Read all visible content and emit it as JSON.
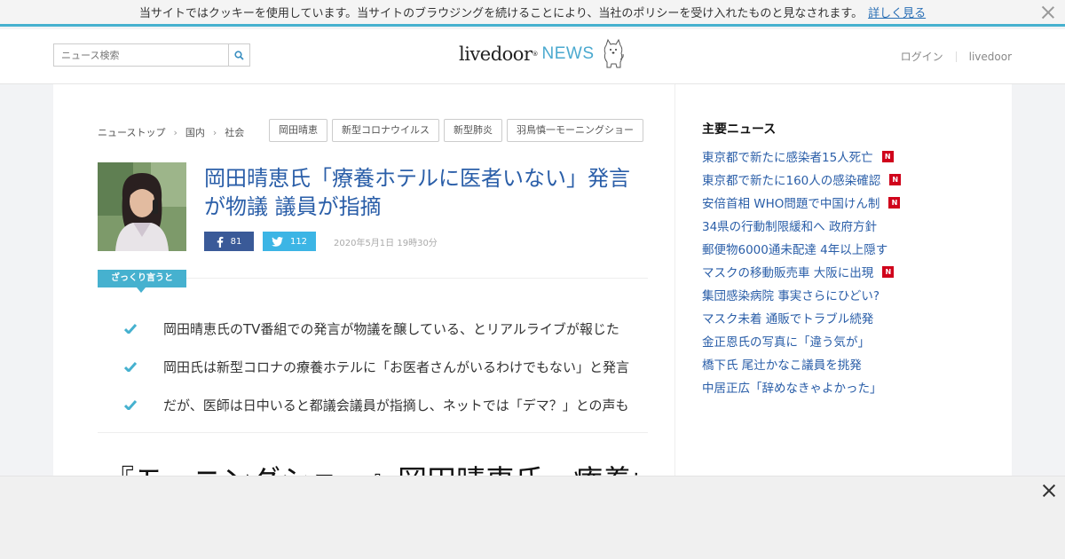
{
  "cookie": {
    "text": "当サイトではクッキーを使用しています。当サイトのブラウジングを続けることにより、当社のポリシーを受け入れたものと見なされます。",
    "link": "詳しく見る"
  },
  "header": {
    "search_placeholder": "ニュース検索",
    "logo_main": "livedoor",
    "logo_reg": "®",
    "logo_news": "NEWS",
    "login": "ログイン",
    "livedoor": "livedoor"
  },
  "breadcrumb": [
    "ニューストップ",
    "国内",
    "社会"
  ],
  "tags": [
    "岡田晴恵",
    "新型コロナウイルス",
    "新型肺炎",
    "羽鳥慎一モーニングショー"
  ],
  "article": {
    "title": "岡田晴恵氏「療養ホテルに医者いない」発言が物議 議員が指摘",
    "fb_count": "81",
    "tw_count": "112",
    "date": "2020年5月1日 19時30分",
    "summary_label": "ざっくり言うと",
    "summary": [
      "岡田晴恵氏のTV番組での発言が物議を醸している、とリアルライブが報じた",
      "岡田氏は新型コロナの療養ホテルに「お医者さんがいるわけでもない」と発言",
      "だが、医師は日中いると都議会議員が指摘し、ネットでは「デマ？」との声も"
    ],
    "body_heading": "『モーニングショー』岡田晴恵氏、療養ホテ"
  },
  "sidebar": {
    "title": "主要ニュース",
    "news": [
      {
        "text": "東京都で新たに感染者15人死亡",
        "new": true
      },
      {
        "text": "東京都で新たに160人の感染確認",
        "new": true
      },
      {
        "text": "安倍首相 WHO問題で中国けん制",
        "new": true
      },
      {
        "text": "34県の行動制限緩和へ 政府方針",
        "new": false
      },
      {
        "text": "郵便物6000通未配達 4年以上隠す",
        "new": false
      },
      {
        "text": "マスクの移動販売車 大阪に出現",
        "new": true
      },
      {
        "text": "集団感染病院 事実さらにひどい?",
        "new": false
      },
      {
        "text": "マスク未着 通販でトラブル続発",
        "new": false
      },
      {
        "text": "金正恩氏の写真に「違う気が」",
        "new": false
      },
      {
        "text": "橋下氏 尾辻かなこ議員を挑発",
        "new": false
      },
      {
        "text": "中居正広「辞めなきゃよかった」",
        "new": false
      }
    ],
    "badge_label": "N"
  },
  "colors": {
    "accent": "#46b1cf",
    "link": "#2a5ea8",
    "facebook": "#3a5a98",
    "twitter": "#3cb5e5",
    "new_badge": "#d0021b"
  }
}
